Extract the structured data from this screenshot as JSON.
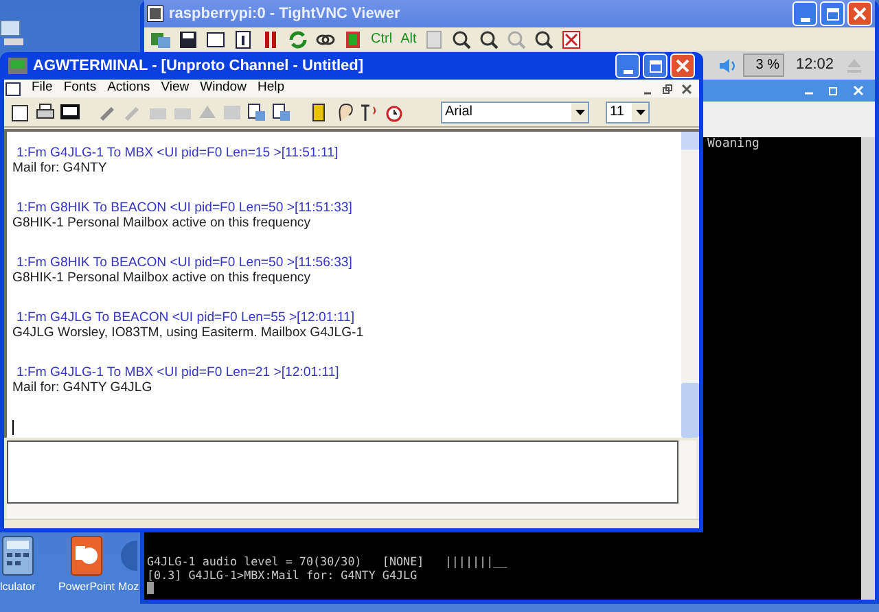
{
  "desktop_icons": [
    {
      "label": "lculator",
      "kind": "calculator"
    },
    {
      "label": "PowerPoint",
      "kind": "powerpoint"
    },
    {
      "label": "Moz",
      "kind": "browser"
    }
  ],
  "vnc_window": {
    "title": "raspberrypi:0 - TightVNC Viewer",
    "toolbar_labels": [
      "Ctrl",
      "Alt"
    ]
  },
  "remote_panel": {
    "cpu": "3 %",
    "clock": "12:02"
  },
  "remote_terminal": {
    "top_lines": [
      "Woaning"
    ],
    "bottom_lines": [
      "G4JLG-1 audio level = 70(30/30)   [NONE]   |||||||__",
      "[0.3] G4JLG-1>MBX:Mail for: G4NTY G4JLG"
    ]
  },
  "agw_window": {
    "title": "AGWTERMINAL - [Unproto Channel - Untitled]",
    "menu": [
      "File",
      "Fonts",
      "Actions",
      "View",
      "Window",
      "Help"
    ],
    "font": "Arial",
    "font_size": "11",
    "messages": [
      {
        "header": "1:Fm G4JLG-1 To MBX <UI pid=F0 Len=15 >[11:51:11]",
        "body": "Mail for: G4NTY"
      },
      {
        "header": "1:Fm G8HIK To BEACON <UI pid=F0 Len=50 >[11:51:33]",
        "body": "G8HIK-1 Personal Mailbox active on this frequency"
      },
      {
        "header": "1:Fm G8HIK To BEACON <UI pid=F0 Len=50 >[11:56:33]",
        "body": "G8HIK-1 Personal Mailbox active on this frequency"
      },
      {
        "header": "1:Fm G4JLG To BEACON <UI pid=F0 Len=55 >[12:01:11]",
        "body": "G4JLG Worsley, IO83TM, using Easiterm.  Mailbox G4JLG-1"
      },
      {
        "header": "1:Fm G4JLG-1 To MBX <UI pid=F0 Len=21 >[12:01:11]",
        "body": "Mail for: G4NTY G4JLG"
      }
    ]
  }
}
